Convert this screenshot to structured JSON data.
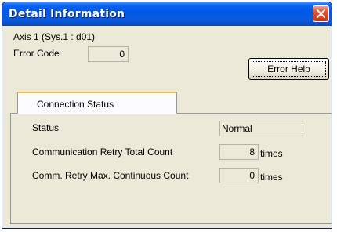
{
  "window": {
    "title": "Detail Information"
  },
  "header": {
    "axis_label": "Axis  1 (Sys.1 : d01)",
    "error_code_label": "Error Code",
    "error_code_value": "0",
    "error_help_label": "Error Help"
  },
  "tabs": [
    {
      "label": "Connection Status"
    }
  ],
  "connection_status": {
    "status_label": "Status",
    "status_value": "Normal",
    "retry_total_label": "Communication Retry Total Count",
    "retry_total_value": "8",
    "retry_total_unit": "times",
    "retry_max_label": "Comm. Retry Max. Continuous Count",
    "retry_max_value": "0",
    "retry_max_unit": "times"
  },
  "colors": {
    "titlebar": "#0058e6",
    "close_button": "#d9421e",
    "dialog_background": "#ece9d8"
  }
}
